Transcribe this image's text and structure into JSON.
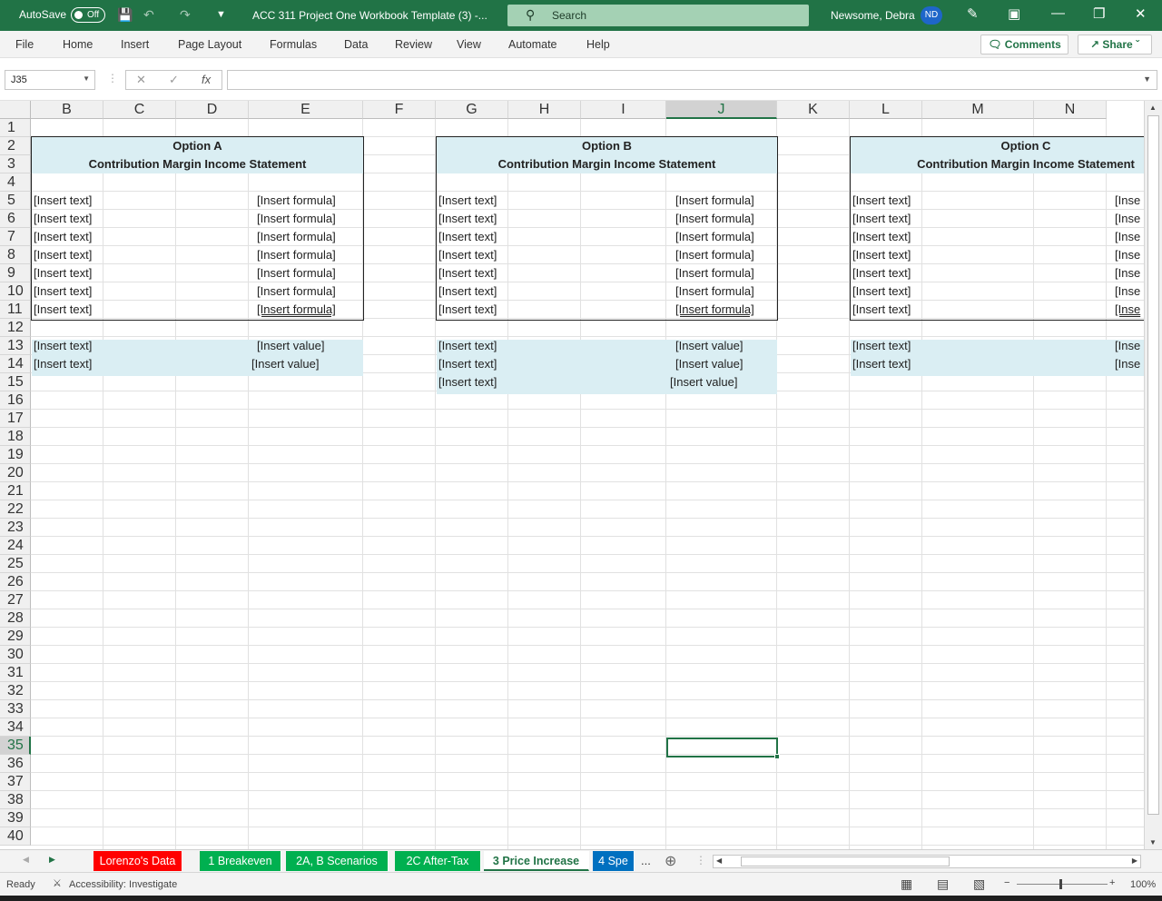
{
  "titlebar": {
    "autosave_label": "AutoSave",
    "autosave_state": "Off",
    "doc_title": "ACC 311 Project One Workbook Template (3)  -...",
    "search_placeholder": "Search",
    "user_name": "Newsome, Debra",
    "user_initials": "ND"
  },
  "menu": [
    "File",
    "Home",
    "Insert",
    "Page Layout",
    "Formulas",
    "Data",
    "Review",
    "View",
    "Automate",
    "Help"
  ],
  "comments_label": "Comments",
  "share_label": "Share",
  "formula_bar": {
    "name_box": "J35",
    "fx": "fx",
    "formula": ""
  },
  "columns": [
    "B",
    "C",
    "D",
    "E",
    "F",
    "G",
    "H",
    "I",
    "J",
    "K",
    "L",
    "M",
    "N"
  ],
  "selected_column": "J",
  "rows": [
    "1",
    "2",
    "3",
    "4",
    "5",
    "6",
    "7",
    "8",
    "9",
    "10",
    "11",
    "12",
    "13",
    "14",
    "15",
    "16",
    "17",
    "18",
    "19",
    "20",
    "21",
    "22",
    "23",
    "24",
    "25",
    "26",
    "27",
    "28",
    "29",
    "30",
    "31",
    "32",
    "33",
    "34",
    "35",
    "36",
    "37",
    "38",
    "39",
    "40"
  ],
  "selected_row": "35",
  "sections": [
    {
      "title": "Option A",
      "subtitle": "Contribution Margin Income Statement"
    },
    {
      "title": "Option B",
      "subtitle": "Contribution Margin Income Statement"
    },
    {
      "title": "Option C",
      "subtitle": "Contribution Margin Income Statement"
    }
  ],
  "placeholders": {
    "text": "[Insert text]",
    "formula": "[Insert formula]",
    "value": "[Insert value]",
    "truncated": "[Inse"
  },
  "sheet_tabs": [
    {
      "label": "Lorenzo's Data",
      "color": "#ff0000"
    },
    {
      "label": "1 Breakeven",
      "color": "#00b050"
    },
    {
      "label": "2A, B Scenarios",
      "color": "#00b050"
    },
    {
      "label": "2C After-Tax",
      "color": "#00b050"
    },
    {
      "label": "3 Price Increase",
      "color": "#ffffff",
      "active": true
    },
    {
      "label": "4 Spe",
      "color": "#0070c0"
    }
  ],
  "tab_more": "...",
  "status": {
    "ready": "Ready",
    "accessibility": "Accessibility: Investigate",
    "zoom": "100%"
  },
  "colors": {
    "excel_green": "#217346",
    "fill_blue": "#daeef3"
  }
}
